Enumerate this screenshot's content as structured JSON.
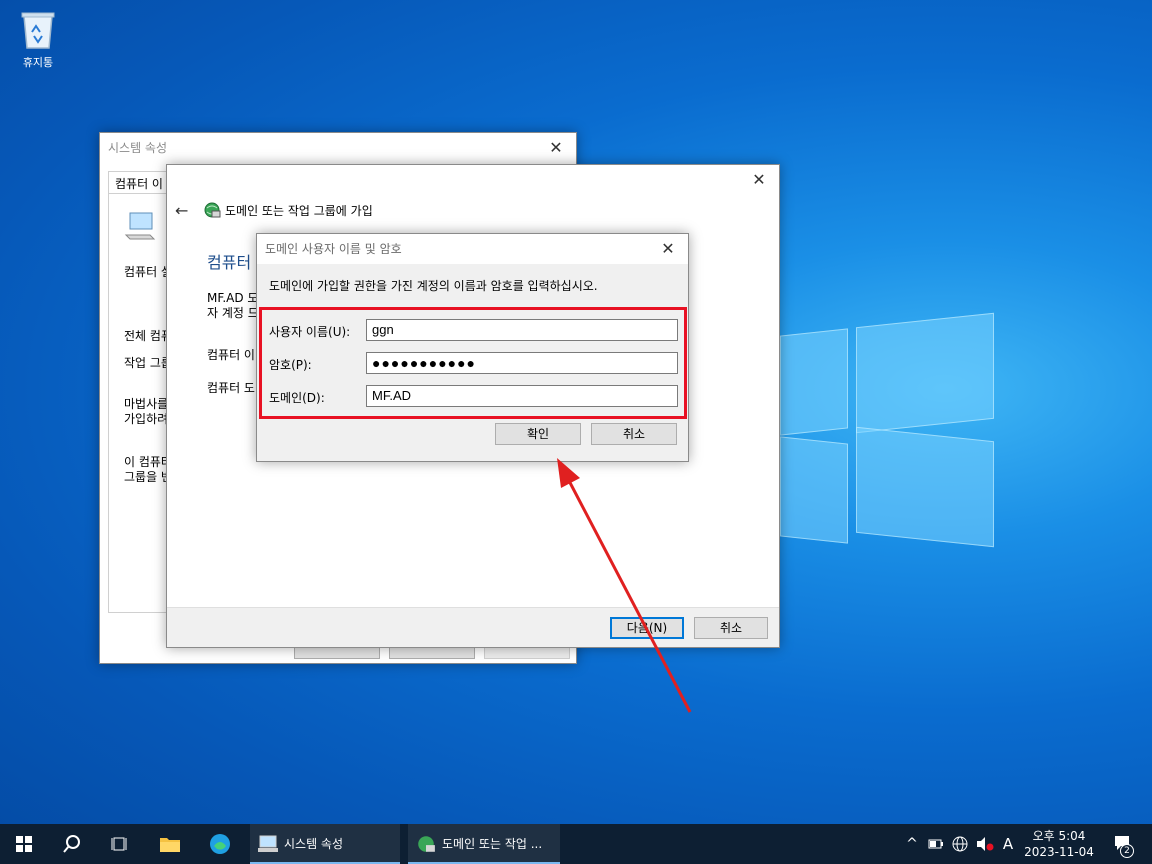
{
  "desktop": {
    "recycle_bin_label": "휴지통"
  },
  "system_properties": {
    "title": "시스템 속성",
    "tab_label": "컴퓨터 이",
    "text_1": "컴퓨터 설",
    "text_2": "전체 컴퓨",
    "text_3": "작업 그룹",
    "text_4a": "마법사를",
    "text_4b": "가입하려",
    "text_5a": "이 컴퓨터",
    "text_5b": "그룹을 변"
  },
  "join_wizard": {
    "title": "도메인 또는 작업 그룹에 가입",
    "heading": "컴퓨터",
    "text_1a": "MF.AD 도",
    "text_1b": "자 계정 드",
    "text_2": "컴퓨터 이",
    "text_3": "컴퓨터 도",
    "next_button": "다음(N)",
    "cancel_button": "취소"
  },
  "credentials_dialog": {
    "title": "도메인 사용자 이름 및 암호",
    "instruction": "도메인에 가입할 권한을 가진 계정의 이름과 암호를 입력하십시오.",
    "username_label": "사용자 이름(U):",
    "username_value": "ggn",
    "password_label": "암호(P):",
    "password_value": "●●●●●●●●●●●",
    "domain_label": "도메인(D):",
    "domain_value": "MF.AD",
    "ok_button": "확인",
    "cancel_button": "취소"
  },
  "taskbar": {
    "apps": [
      {
        "label": "시스템 속성"
      },
      {
        "label": "도메인 또는 작업 ..."
      }
    ],
    "clock_time": "오후 5:04",
    "clock_date": "2023-11-04",
    "ime_indicator": "A",
    "notification_count": "2"
  },
  "colors": {
    "highlight_box": "#e81123",
    "arrow": "#e02020",
    "link_blue": "#1e4e8c"
  }
}
